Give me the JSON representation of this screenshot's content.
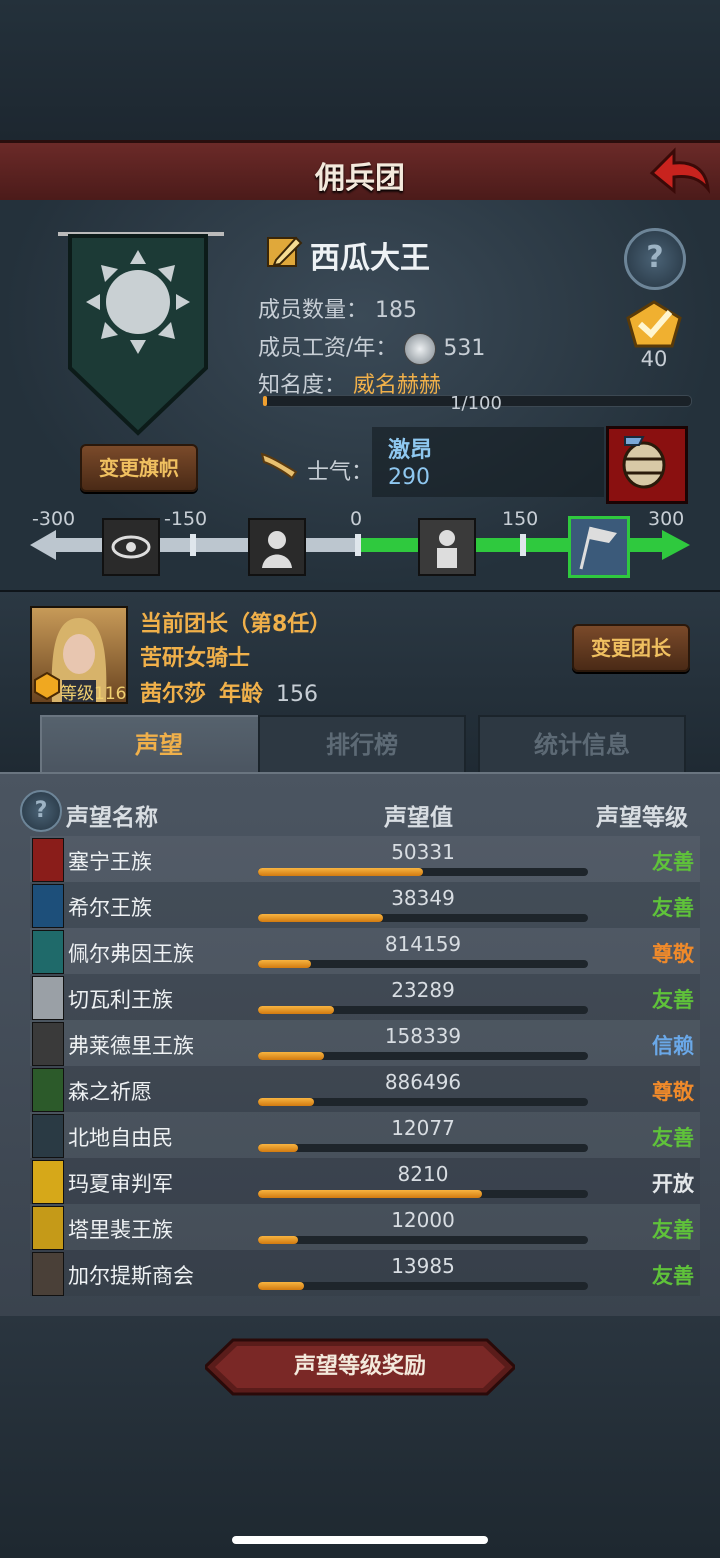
{
  "header": {
    "title": "佣兵团"
  },
  "legion": {
    "name": "西瓜大王",
    "members_label": "成员数量：",
    "members": "185",
    "wage_label": "成员工资/年：",
    "wage": "531",
    "fame_label": "知名度：",
    "fame_value": "威名赫赫",
    "fame_progress_text": "1/100",
    "fame_progress": 0.01,
    "badge_number": "40",
    "change_flag_label": "变更旗帜"
  },
  "morale": {
    "label": "士气：",
    "state": "激昂",
    "value": "290",
    "scale_ticks": [
      "-300",
      "-150",
      "0",
      "150",
      "300"
    ]
  },
  "leader": {
    "title": "当前团长（第8任）",
    "class": "苦研女骑士",
    "name": "茜尔莎",
    "age_label": "年龄",
    "age": "156",
    "level_label": "等级",
    "level": "116",
    "change_leader_label": "变更团长"
  },
  "tabs": [
    {
      "label": "声望"
    },
    {
      "label": "排行榜"
    },
    {
      "label": "统计信息"
    }
  ],
  "reputation": {
    "col_name": "声望名称",
    "col_value": "声望值",
    "col_level": "声望等级",
    "rows": [
      {
        "name": "塞宁王族",
        "value": "50331",
        "progress": 0.5,
        "level": "友善",
        "level_color": "#5fc23a",
        "emblem_color": "#8a1d1a"
      },
      {
        "name": "希尔王族",
        "value": "38349",
        "progress": 0.38,
        "level": "友善",
        "level_color": "#5fc23a",
        "emblem_color": "#1d4f7a"
      },
      {
        "name": "佩尔弗因王族",
        "value": "814159",
        "progress": 0.16,
        "level": "尊敬",
        "level_color": "#f08a2a",
        "emblem_color": "#1f6a6a"
      },
      {
        "name": "切瓦利王族",
        "value": "23289",
        "progress": 0.23,
        "level": "友善",
        "level_color": "#5fc23a",
        "emblem_color": "#9aa0a6"
      },
      {
        "name": "弗莱德里王族",
        "value": "158339",
        "progress": 0.2,
        "level": "信赖",
        "level_color": "#6aa8e8",
        "emblem_color": "#3a3a3a"
      },
      {
        "name": "森之祈愿",
        "value": "886496",
        "progress": 0.17,
        "level": "尊敬",
        "level_color": "#f08a2a",
        "emblem_color": "#2c5a2a"
      },
      {
        "name": "北地自由民",
        "value": "12077",
        "progress": 0.12,
        "level": "友善",
        "level_color": "#5fc23a",
        "emblem_color": "#2a3a44"
      },
      {
        "name": "玛夏审判军",
        "value": "8210",
        "progress": 0.68,
        "level": "开放",
        "level_color": "#e4e7ea",
        "emblem_color": "#d6a819"
      },
      {
        "name": "塔里裴王族",
        "value": "12000",
        "progress": 0.12,
        "level": "友善",
        "level_color": "#5fc23a",
        "emblem_color": "#c59a18"
      },
      {
        "name": "加尔提斯商会",
        "value": "13985",
        "progress": 0.14,
        "level": "友善",
        "level_color": "#5fc23a",
        "emblem_color": "#4a4038"
      }
    ]
  },
  "reward_button_label": "声望等级奖励"
}
